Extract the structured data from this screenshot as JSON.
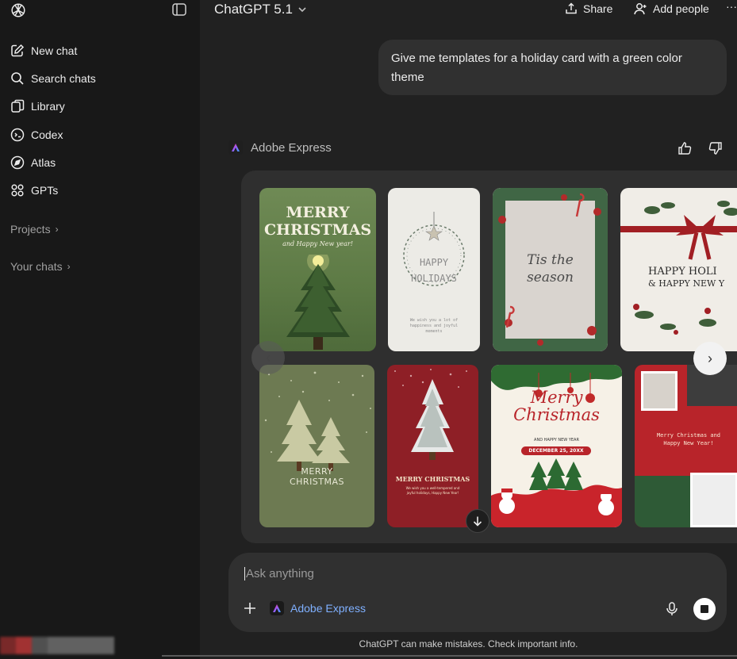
{
  "sidebar": {
    "items": [
      {
        "label": "New chat",
        "icon": "pencil-square-icon"
      },
      {
        "label": "Search chats",
        "icon": "search-icon"
      },
      {
        "label": "Library",
        "icon": "library-icon"
      },
      {
        "label": "Codex",
        "icon": "codex-icon"
      },
      {
        "label": "Atlas",
        "icon": "compass-icon"
      },
      {
        "label": "GPTs",
        "icon": "grid-icon"
      }
    ],
    "projects_label": "Projects",
    "chats_label": "Your chats"
  },
  "header": {
    "model": "ChatGPT 5.1",
    "share_label": "Share",
    "add_people_label": "Add people",
    "more_label": "···"
  },
  "user_message": "Give me templates for a holiday card with a green color theme",
  "assistant": {
    "app_name": "Adobe Express",
    "templates": [
      {
        "line1": "MERRY",
        "line2": "CHRISTMAS",
        "line3": "and Happy New year!"
      },
      {
        "line1": "HAPPY",
        "line2": "HOLIDAYS",
        "line3": "We wish you a lot of happiness and joyful moments"
      },
      {
        "line1": "Tis the",
        "line2": "season"
      },
      {
        "line1": "HAPPY HOLI",
        "line2": "& HAPPY NEW Y"
      },
      {
        "line1": "MERRY",
        "line2": "CHRISTMAS"
      },
      {
        "line1": "MERRY CHRISTMAS",
        "line2": "We wish you a well-tempered and joyful holidays, Happy New Year!"
      },
      {
        "line1": "Merry",
        "line2": "Christmas",
        "line3": "AND HAPPY NEW YEAR",
        "line4": "DECEMBER 25, 20XX"
      },
      {
        "line1": "Merry Christmas and",
        "line2": "Happy New Year!"
      }
    ]
  },
  "composer": {
    "placeholder": "Ask anything",
    "tool_label": "Adobe Express"
  },
  "footer": "ChatGPT can make mistakes. Check important info.",
  "colors": {
    "background": "#212121",
    "sidebar": "#181818",
    "bubble": "#303030",
    "accent_link": "#7fb0ff"
  }
}
